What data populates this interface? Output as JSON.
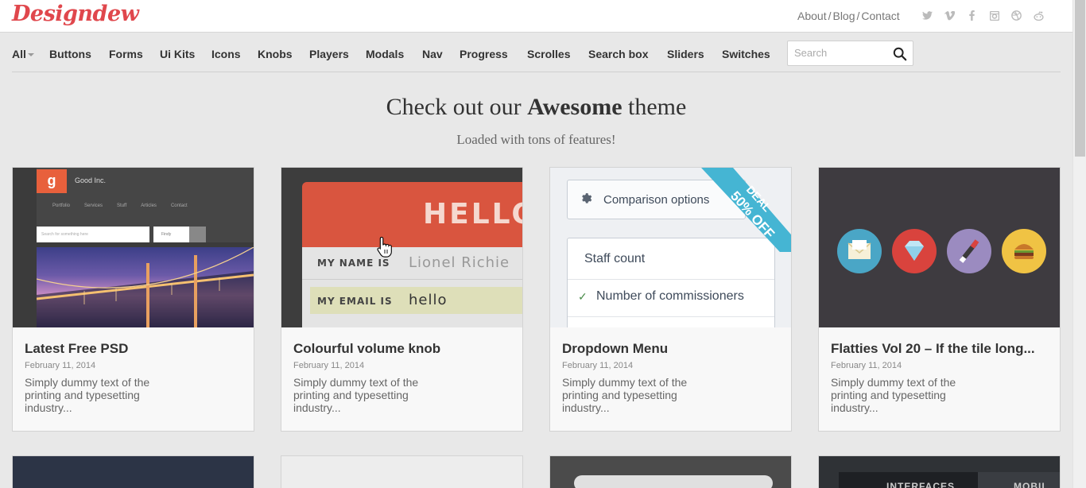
{
  "header": {
    "logo": "Designdew",
    "links": [
      "About",
      "Blog",
      "Contact"
    ],
    "link_sep": "/",
    "social_icons": [
      "twitter-icon",
      "vimeo-icon",
      "facebook-icon",
      "instagram-icon",
      "dribbble-icon",
      "reddit-icon"
    ]
  },
  "nav": {
    "items": [
      "All",
      "Buttons",
      "Forms",
      "Ui Kits",
      "Icons",
      "Knobs",
      "Players",
      "Modals",
      "Nav",
      "Progress",
      "Scrolles",
      "Search box",
      "Sliders",
      "Switches"
    ],
    "search_placeholder": "Search"
  },
  "hero": {
    "title_pre": "Check out our ",
    "title_bold": "Awesome",
    "title_post": " theme",
    "subtitle": "Loaded with tons of features!"
  },
  "cards": [
    {
      "title": "Latest Free PSD",
      "date": "February 11, 2014",
      "desc": "Simply dummy text of the printing and typesetting industry..."
    },
    {
      "title": "Colourful volume knob",
      "date": "February 11, 2014",
      "desc": "Simply dummy text of the printing and typesetting industry..."
    },
    {
      "title": "Dropdown Menu",
      "date": "February 11, 2014",
      "desc": "Simply dummy text of the printing and typesetting industry..."
    },
    {
      "title": "Flatties Vol 20 – If the tile long...",
      "date": "February 11, 2014",
      "desc": "Simply dummy text of the printing and typesetting industry..."
    }
  ],
  "thumb1": {
    "logo_letter": "g",
    "brand": "Good Inc.",
    "links": [
      "Portfolio",
      "Services",
      "Stuff",
      "Articles",
      "Contact"
    ],
    "input_placeholder": "Search for something here",
    "location": "Findy"
  },
  "thumb2": {
    "hello": "HELLO",
    "name_label": "MY NAME IS",
    "name_value": "Lionel Richie",
    "email_label": "MY EMAIL IS",
    "email_value": "hello"
  },
  "thumb3": {
    "button": "Comparison options",
    "ribbon_line1": "DEAL",
    "ribbon_line2": "50% OFF",
    "items": [
      "Staff count",
      "Number of commissioners"
    ],
    "check": "✓"
  },
  "thumb4": {
    "icons": [
      "envelope-icon",
      "diamond-icon",
      "brush-icon",
      "burger-icon"
    ],
    "colors": [
      "#4aa6c6",
      "#d9433d",
      "#9b8bc0",
      "#f0c344"
    ]
  },
  "row2": {
    "interfaces_label": "INTERFACES",
    "mobile_label": "MOBIL"
  },
  "colors": {
    "brand": "#e0474c",
    "ribbon": "#45b5d3"
  }
}
